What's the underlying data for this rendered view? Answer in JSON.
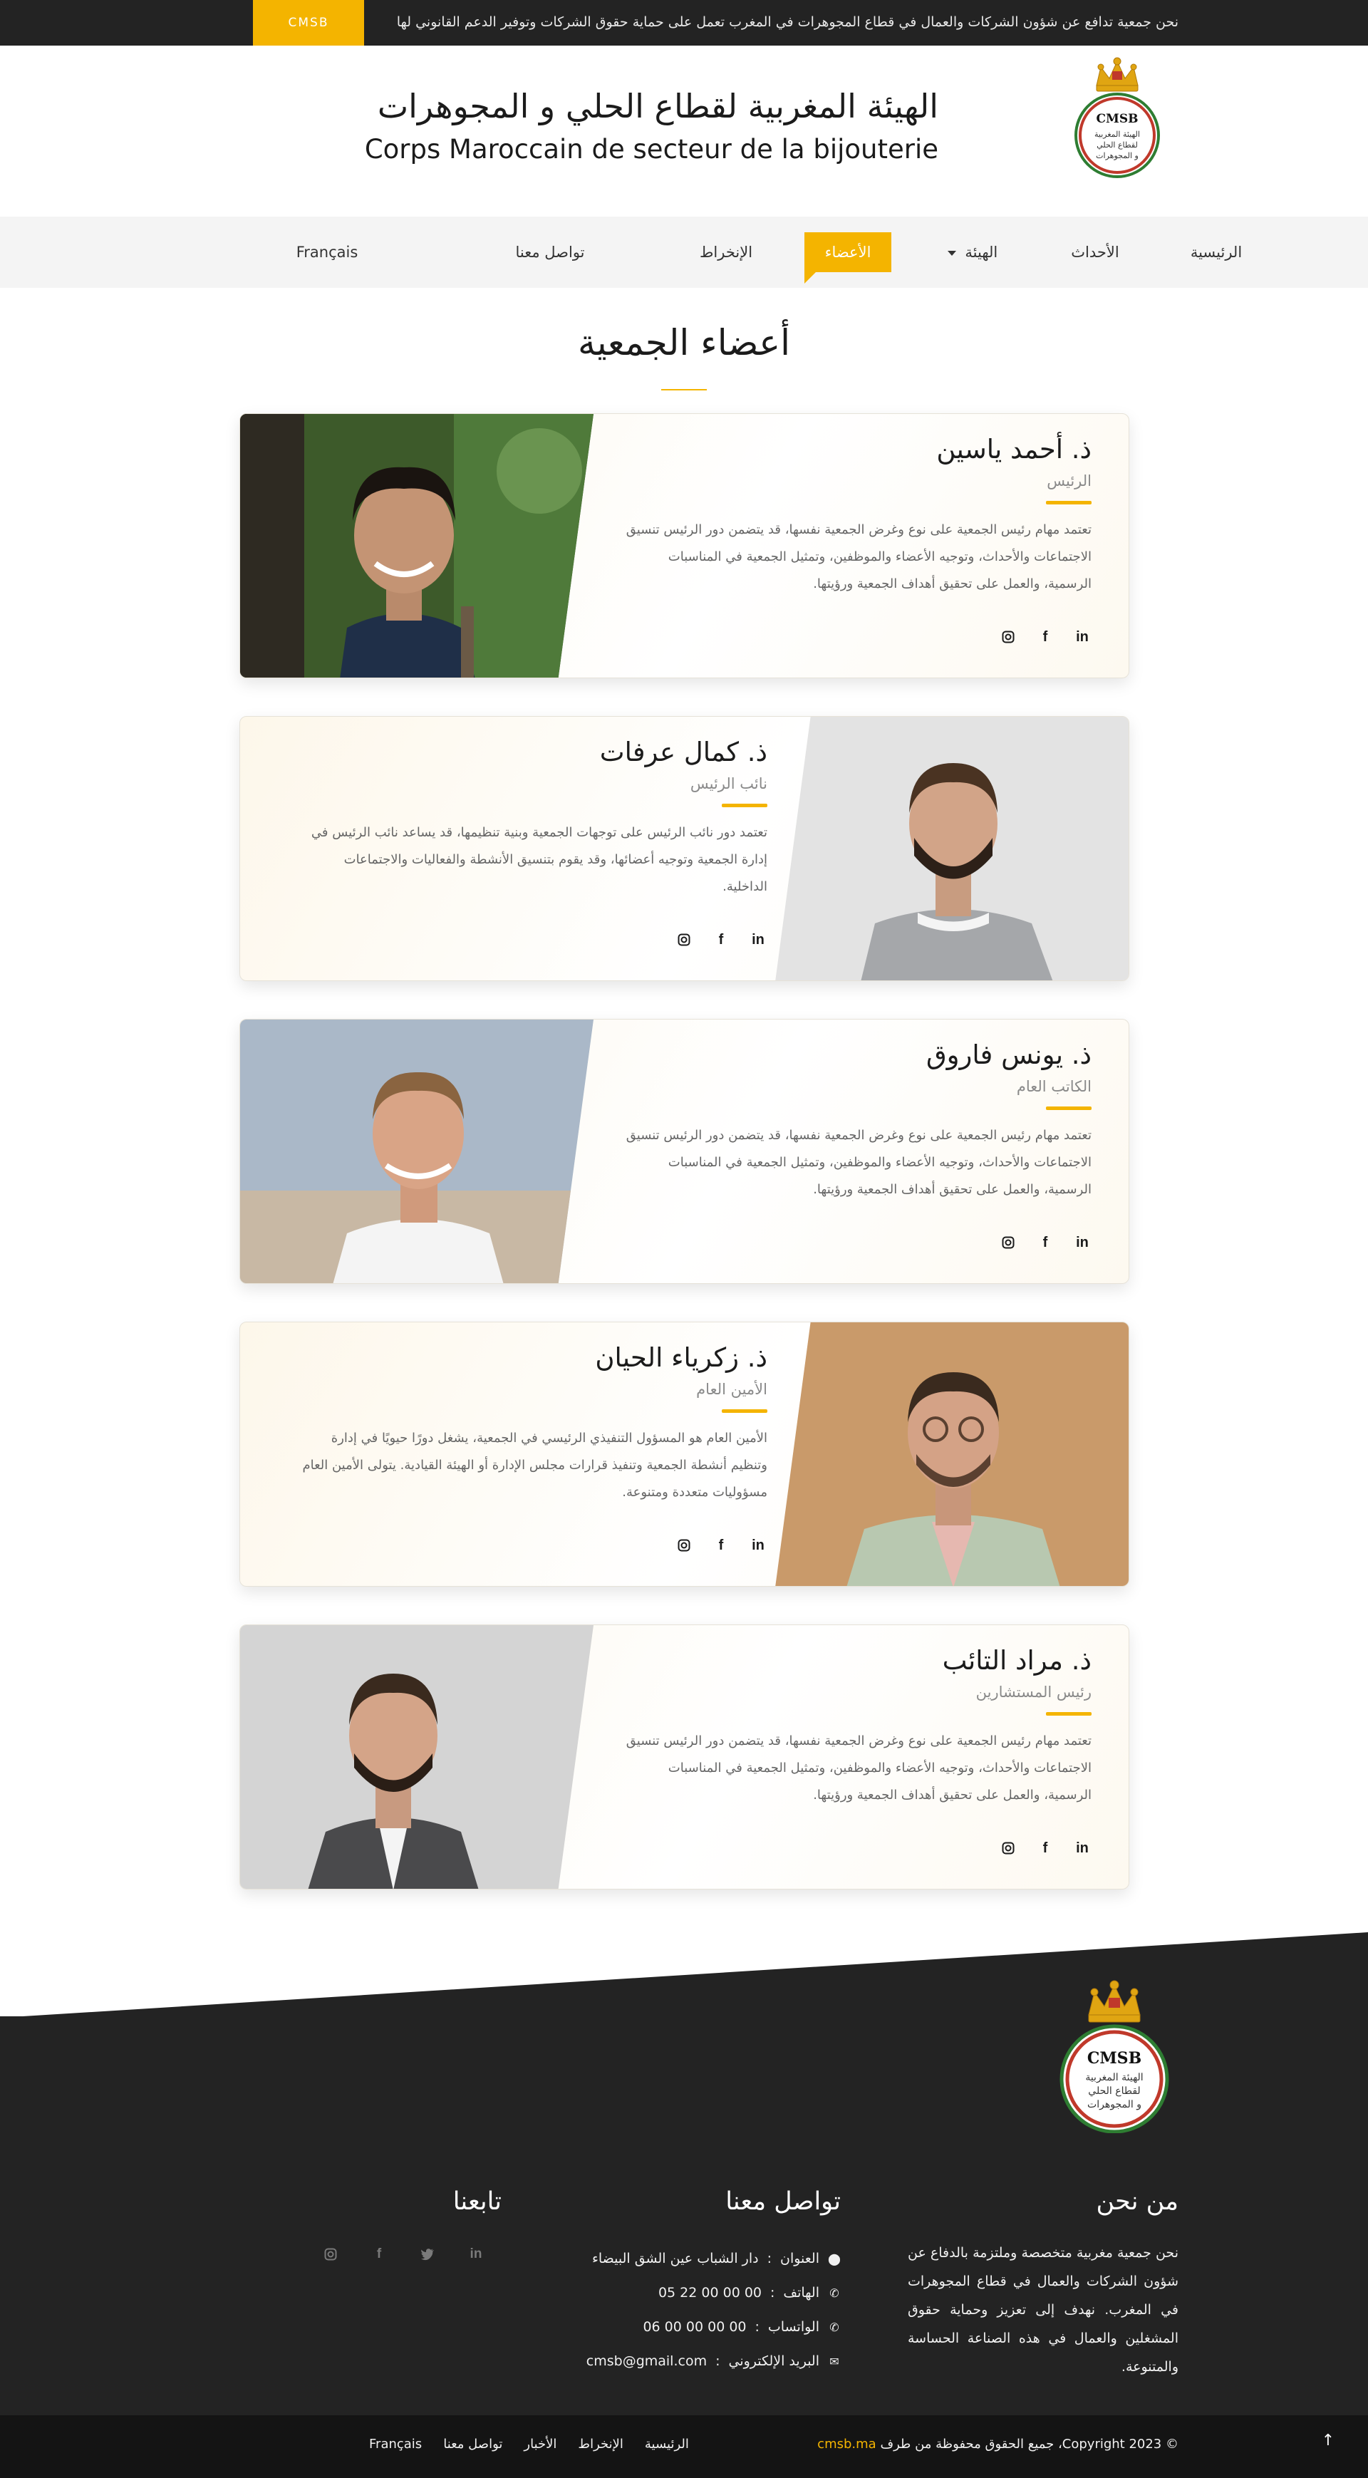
{
  "topbar": {
    "tagline": "نحن جمعية تدافع عن شؤون الشركات والعمال في قطاع المجوهرات في المغرب تعمل على حماية حقوق الشركات وتوفير الدعم القانوني لها",
    "brand_tag": "CMSB"
  },
  "header": {
    "org_name_ar": "الهيئة المغربية لقطاع الحلي و المجوهرات",
    "org_name_fr": "Corps Maroccain de secteur de la bijouterie",
    "logo": {
      "abbr": "CMSB",
      "line1": "الهيئة المغربية",
      "line2": "لقطاع الحلي",
      "line3": "و المجوهرات"
    }
  },
  "nav": {
    "items": [
      {
        "label": "الرئيسية"
      },
      {
        "label": "الأحداث"
      },
      {
        "label": "الهيئة"
      },
      {
        "label": "الأعضاء"
      },
      {
        "label": "الإنخراط"
      },
      {
        "label": "تواصل معنا"
      },
      {
        "label": "Français"
      }
    ],
    "active": "الأعضاء"
  },
  "section": {
    "title": "أعضاء الجمعية"
  },
  "members": [
    {
      "name": "ذ. أحمد ياسين",
      "role": "الرئيس",
      "bio": "تعتمد مهام رئيس الجمعية على نوع وغرض الجمعية نفسها، قد يتضمن دور الرئيس تنسيق الاجتماعات والأحداث، وتوجيه الأعضاء والموظفين، وتمثيل الجمعية في المناسبات الرسمية، والعمل على تحقيق أهداف الجمعية ورؤيتها."
    },
    {
      "name": "ذ. كمال عرفات",
      "role": "نائب الرئيس",
      "bio": "تعتمد دور نائب الرئيس على توجهات الجمعية وبنية تنظيمها، قد يساعد نائب الرئيس في إدارة الجمعية وتوجيه أعضائها، وقد يقوم بتنسيق الأنشطة والفعاليات والاجتماعات الداخلية."
    },
    {
      "name": "ذ. يونس فاروق",
      "role": "الكاتب العام",
      "bio": "تعتمد مهام رئيس الجمعية على نوع وغرض الجمعية نفسها، قد يتضمن دور الرئيس تنسيق الاجتماعات والأحداث، وتوجيه الأعضاء والموظفين، وتمثيل الجمعية في المناسبات الرسمية، والعمل على تحقيق أهداف الجمعية ورؤيتها."
    },
    {
      "name": "ذ. زكرياء الحيان",
      "role": "الأمين العام",
      "bio": "الأمين العام هو المسؤول التنفيذي الرئيسي في الجمعية، يشغل دورًا حيويًا في إدارة وتنظيم أنشطة الجمعية وتنفيذ قرارات مجلس الإدارة أو الهيئة القيادية. يتولى الأمين العام مسؤوليات متعددة ومتنوعة."
    },
    {
      "name": "ذ. مراد التائب",
      "role": "رئيس المستشارين",
      "bio": "تعتمد مهام رئيس الجمعية على نوع وغرض الجمعية نفسها، قد يتضمن دور الرئيس تنسيق الاجتماعات والأحداث، وتوجيه الأعضاء والموظفين، وتمثيل الجمعية في المناسبات الرسمية، والعمل على تحقيق أهداف الجمعية ورؤيتها."
    }
  ],
  "social_icons": [
    "linkedin-icon",
    "facebook-icon",
    "instagram-icon"
  ],
  "footer": {
    "about_title": "من نحن",
    "about_text": "نحن جمعية مغربية متخصصة وملتزمة بالدفاع عن شؤون الشركات والعمال في قطاع المجوهرات في المغرب. نهدف إلى تعزيز وحماية حقوق المشغلين والعمال في هذه الصناعة الحساسة والمتنوعة.",
    "contact_title": "تواصل معنا",
    "contact": [
      {
        "label": "العنوان",
        "sep": ":",
        "value": "دار الشباب عين الشق البيضاء",
        "icon": "map-marker-icon"
      },
      {
        "label": "الهاتف",
        "sep": ":",
        "value": "05 22 00 00 00",
        "icon": "phone-icon"
      },
      {
        "label": "الواتساب",
        "sep": ":",
        "value": "06 00 00 00 00",
        "icon": "whatsapp-icon"
      },
      {
        "label": "البريد الإلكتروني",
        "sep": ":",
        "value": "cmsb@gmail.com",
        "icon": "envelope-icon"
      }
    ],
    "follow_title": "تابعنا",
    "copyright_prefix": "© Copyright 2023،  جميع الحقوق محفوظة من طرف",
    "copyright_site": "cmsb.ma",
    "bottom_nav": [
      "الرئيسية",
      "الإنخراط",
      "الأخبار",
      "تواصل معنا",
      "Français"
    ]
  },
  "colors": {
    "accent": "#f4b400",
    "dark": "#232323",
    "darker": "#141414",
    "nav_bg": "#f4f4f4"
  }
}
